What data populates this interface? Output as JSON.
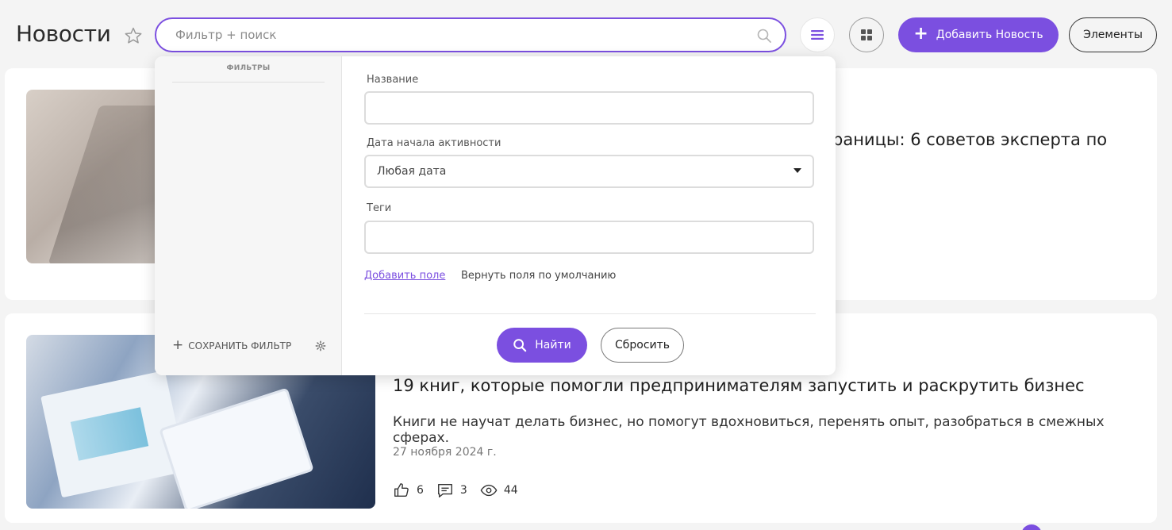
{
  "header": {
    "title": "Новости",
    "search_placeholder": "Фильтр + поиск",
    "add_button_label": "Добавить Новость",
    "elements_button_label": "Элементы"
  },
  "filter_panel": {
    "filters_heading": "ФИЛЬТРЫ",
    "save_filter_label": "СОХРАНИТЬ ФИЛЬТР",
    "fields": {
      "name_label": "Название",
      "name_value": "",
      "date_label": "Дата начала активности",
      "date_value": "Любая дата",
      "tags_label": "Теги",
      "tags_value": ""
    },
    "add_field_link": "Добавить поле",
    "restore_defaults_link": "Вернуть поля по умолчанию",
    "find_button": "Найти",
    "reset_button": "Сбросить"
  },
  "news": [
    {
      "title": "раницы: 6 советов эксперта по"
    },
    {
      "title": "19 книг, которые помогли предпринимателям запустить и раскрутить бизнес",
      "description": "Книги не научат делать бизнес, но помогут вдохновиться, перенять опыт, разобраться в смежных сферах.",
      "date": "27 ноября 2024 г.",
      "likes": "6",
      "comments": "3",
      "views": "44"
    }
  ],
  "colors": {
    "accent": "#7b4fe0",
    "background": "#f4f4f4"
  }
}
